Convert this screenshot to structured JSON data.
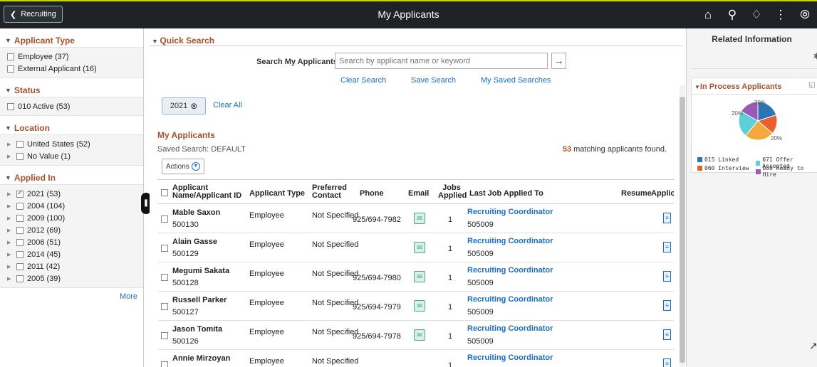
{
  "topbar": {
    "back_label": "Recruiting",
    "title": "My Applicants",
    "icons": [
      "home-icon",
      "search-icon",
      "bell-icon",
      "more-vertical-icon",
      "compass-icon"
    ]
  },
  "facets": {
    "applicant_type": {
      "title": "Applicant Type",
      "options": [
        {
          "label": "Employee (37)",
          "checked": false
        },
        {
          "label": "External Applicant (16)",
          "checked": false
        }
      ]
    },
    "status": {
      "title": "Status",
      "options": [
        {
          "label": "010 Active (53)",
          "checked": false
        }
      ]
    },
    "location": {
      "title": "Location",
      "options": [
        {
          "label": "United States (52)",
          "checked": false
        },
        {
          "label": "No Value (1)",
          "checked": false
        }
      ]
    },
    "applied_in": {
      "title": "Applied In",
      "options": [
        {
          "label": "2021 (53)",
          "checked": true
        },
        {
          "label": "2004 (104)",
          "checked": false
        },
        {
          "label": "2009 (100)",
          "checked": false
        },
        {
          "label": "2012 (69)",
          "checked": false
        },
        {
          "label": "2006 (51)",
          "checked": false
        },
        {
          "label": "2014 (45)",
          "checked": false
        },
        {
          "label": "2011 (42)",
          "checked": false
        },
        {
          "label": "2005 (39)",
          "checked": false
        }
      ]
    },
    "more_label": "More"
  },
  "quick_search": {
    "title": "Quick Search",
    "label": "Search My Applicants",
    "placeholder": "Search by applicant name or keyword",
    "links": {
      "clear": "Clear Search",
      "save": "Save Search",
      "saved": "My Saved Searches"
    },
    "chip": "2021",
    "clear_all": "Clear All"
  },
  "applicants": {
    "title": "My Applicants",
    "saved_search": "Saved Search:  DEFAULT",
    "count": "53",
    "count_suffix": " matching applicants found.",
    "actions_label": "Actions",
    "columns": {
      "name": "Applicant Name/Applicant ID",
      "type": "Applicant Type",
      "contact": "Preferred Contact",
      "phone": "Phone",
      "email": "Email",
      "jobs": "Jobs Applied",
      "last_job": "Last Job Applied To",
      "resume": "Resume",
      "applic": "Applic"
    },
    "rows": [
      {
        "name": "Mable Saxon",
        "id": "500130",
        "type": "Employee",
        "contact": "Not Specified",
        "phone": "925/694-7982",
        "jobs": "1",
        "job": "Recruiting Coordinator",
        "job_id": "505009"
      },
      {
        "name": "Alain Gasse",
        "id": "500129",
        "type": "Employee",
        "contact": "Not Specified",
        "phone": "",
        "jobs": "1",
        "job": "Recruiting Coordinator",
        "job_id": "505009"
      },
      {
        "name": "Megumi Sakata",
        "id": "500128",
        "type": "Employee",
        "contact": "Not Specified",
        "phone": "925/694-7980",
        "jobs": "1",
        "job": "Recruiting Coordinator",
        "job_id": "505009"
      },
      {
        "name": "Russell Parker",
        "id": "500127",
        "type": "Employee",
        "contact": "Not Specified",
        "phone": "925/694-7979",
        "jobs": "1",
        "job": "Recruiting Coordinator",
        "job_id": "505009"
      },
      {
        "name": "Jason Tomita",
        "id": "500126",
        "type": "Employee",
        "contact": "Not Specified",
        "phone": "925/694-7978",
        "jobs": "1",
        "job": "Recruiting Coordinator",
        "job_id": "505009"
      },
      {
        "name": "Annie Mirzoyan",
        "id": "",
        "type": "Employee",
        "contact": "Not Specified",
        "phone": "",
        "jobs": "1",
        "job": "Recruiting Coordinator",
        "job_id": ""
      }
    ]
  },
  "related": {
    "title": "Related Information",
    "pane_title": "In Process Applicants",
    "pie_labels": [
      "20%",
      "20%",
      "20%"
    ],
    "legend": [
      {
        "label": "015 Linked",
        "color": "#2e74b5"
      },
      {
        "label": "071 Offer Accepted",
        "color": "#5cd0d8"
      },
      {
        "label": "060 Interview",
        "color": "#e8612c"
      },
      {
        "label": "080 Ready to Hire",
        "color": "#9b59b6"
      }
    ]
  },
  "colors": {
    "accent": "#a5512a",
    "link": "#1a6ec0",
    "topbar": "#1f2328"
  }
}
